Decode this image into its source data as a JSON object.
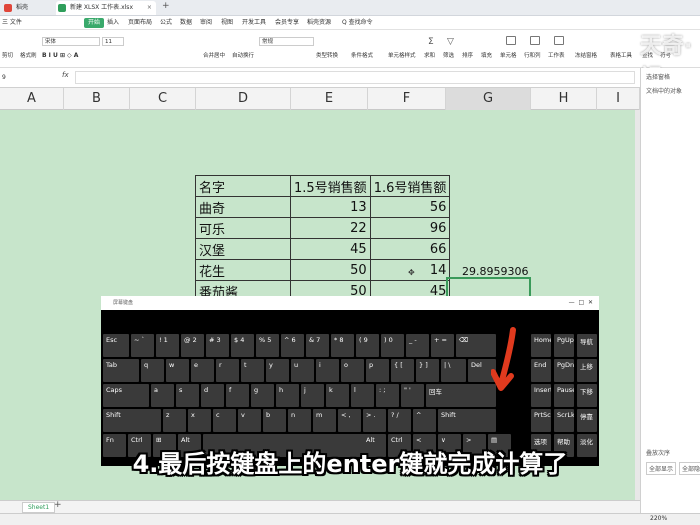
{
  "tabs": [
    {
      "label": "稻壳"
    },
    {
      "label": "新建 XLSX 工作表.xlsx"
    }
  ],
  "menus": [
    "三 文件",
    "开始",
    "插入",
    "页面布局",
    "公式",
    "数据",
    "审阅",
    "视图",
    "开发工具",
    "会员专享",
    "稻壳资源",
    "Q 查找命令"
  ],
  "toolbar": {
    "clipboard": [
      "剪切",
      "格式刷"
    ],
    "font": "宋体",
    "font_size": "11",
    "merge": "合并居中",
    "wrap": "自动换行",
    "numfmt": "常规",
    "type_convert": "类型转换",
    "cond": "条件格式",
    "cellstyle": "单元格样式",
    "sum": "求和",
    "filter": "筛选",
    "sort": "排序",
    "fill": "填充",
    "cell": "单元格",
    "rowcol": "行和列",
    "sheet": "工作表",
    "freeze": "冻结窗格",
    "tablestyle": "表格工具",
    "find": "查找",
    "symbol": "符号"
  },
  "namebox": "9",
  "fx": "fx",
  "columns": [
    "A",
    "B",
    "C",
    "D",
    "E",
    "F",
    "G",
    "H",
    "I"
  ],
  "table": {
    "headers": [
      "名字",
      "1.5号销售额",
      "1.6号销售额"
    ],
    "rows": [
      [
        "曲奇",
        "13",
        "56"
      ],
      [
        "可乐",
        "22",
        "96"
      ],
      [
        "汉堡",
        "45",
        "66"
      ],
      [
        "花生",
        "50",
        "14"
      ],
      [
        "番茄酱",
        "50",
        "45"
      ]
    ]
  },
  "g_result": "29.8959306",
  "right_panel": {
    "title": "选择窗格",
    "subtitle": "文档中的对象",
    "footer1": "叠放次序",
    "footer2": "全部显示",
    "footer3": "全部隐藏"
  },
  "sheet_tab": "Sheet1",
  "zoom": "220%",
  "keyboard": {
    "title": "屏幕键盘",
    "row1": [
      "Esc",
      "~ `",
      "! 1",
      "@ 2",
      "# 3",
      "$ 4",
      "% 5",
      "^ 6",
      "& 7",
      "* 8",
      "( 9",
      ") 0",
      "_ -",
      "+ =",
      "⌫"
    ],
    "row2": [
      "Tab",
      "q",
      "w",
      "e",
      "r",
      "t",
      "y",
      "u",
      "i",
      "o",
      "p",
      "{ [",
      "} ]",
      "| \\",
      "Del"
    ],
    "row3": [
      "Caps",
      "a",
      "s",
      "d",
      "f",
      "g",
      "h",
      "j",
      "k",
      "l",
      ": ;",
      "\" '",
      "回车"
    ],
    "row4": [
      "Shift",
      "z",
      "x",
      "c",
      "v",
      "b",
      "n",
      "m",
      "< ,",
      "> .",
      "? /",
      "^",
      "Shift"
    ],
    "row5": [
      "Fn",
      "Ctrl",
      "⊞",
      "Alt",
      "",
      "Alt",
      "Ctrl",
      "<",
      "∨",
      ">",
      "▤"
    ],
    "right": [
      [
        "Home",
        "PgUp"
      ],
      [
        "End",
        "PgDn",
        "上移"
      ],
      [
        "Insert",
        "Pause",
        "下移"
      ],
      [
        "PrtScn",
        "ScrLk",
        "停靠"
      ],
      [
        "选项",
        "帮助",
        "淡化"
      ]
    ],
    "right_r1": [
      "Home",
      "PgUp",
      "导航"
    ]
  },
  "caption": "4.最后按键盘上的enter键就完成计算了",
  "watermark": "天奇·视"
}
